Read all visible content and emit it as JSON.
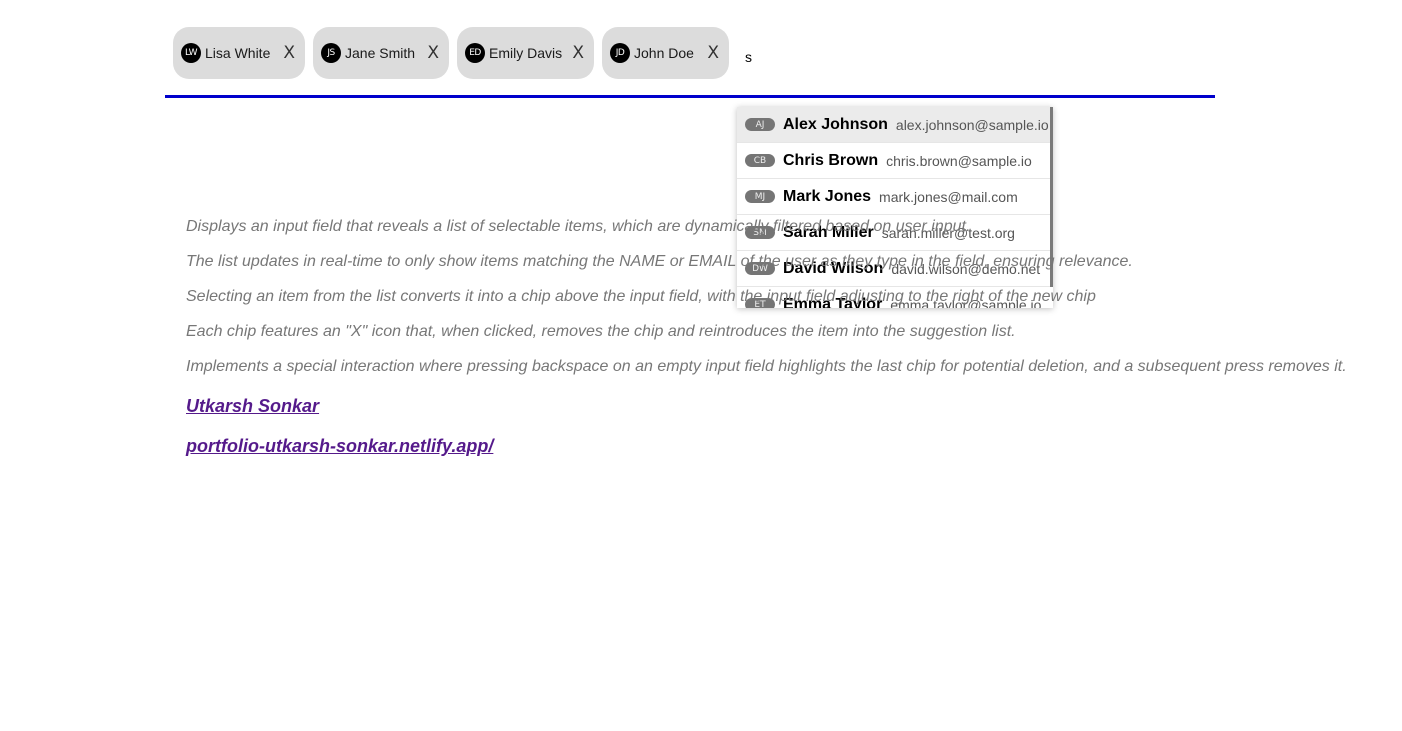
{
  "chips": [
    {
      "initials": "LW",
      "name": "Lisa White",
      "remove_label": "X"
    },
    {
      "initials": "JS",
      "name": "Jane Smith",
      "remove_label": "X"
    },
    {
      "initials": "ED",
      "name": "Emily Davis",
      "remove_label": "X"
    },
    {
      "initials": "JD",
      "name": "John Doe",
      "remove_label": "X"
    }
  ],
  "input": {
    "value": "s",
    "placeholder": ""
  },
  "suggestions": [
    {
      "initials": "AJ",
      "name": "Alex Johnson",
      "email": "alex.johnson@sample.io",
      "highlighted": true
    },
    {
      "initials": "CB",
      "name": "Chris Brown",
      "email": "chris.brown@sample.io"
    },
    {
      "initials": "MJ",
      "name": "Mark Jones",
      "email": "mark.jones@mail.com"
    },
    {
      "initials": "SM",
      "name": "Sarah Miller",
      "email": "sarah.miller@test.org"
    },
    {
      "initials": "DW",
      "name": "David Wilson",
      "email": "david.wilson@demo.net"
    },
    {
      "initials": "ET",
      "name": "Emma Taylor",
      "email": "emma.taylor@sample.io"
    }
  ],
  "description": [
    "Displays an input field that reveals a list of selectable items, which are dynamically filtered based on user input.",
    "The list updates in real-time to only show items matching the NAME or EMAIL of the user as they type in the field, ensuring relevance.",
    "Selecting an item from the list converts it into a chip above the input field, with the input field adjusting to the right of the new chip",
    "Each chip features an \"X\" icon that, when clicked, removes the chip and reintroduces the item into the suggestion list.",
    "Implements a special interaction where pressing backspace on an empty input field highlights the last chip for potential deletion, and a subsequent press removes it."
  ],
  "links": {
    "author": "Utkarsh Sonkar",
    "portfolio": "portfolio-utkarsh-sonkar.netlify.app/"
  },
  "colors": {
    "underline": "#0000cc",
    "chip_bg": "#dcdcdc",
    "link": "#551a8b",
    "description_text": "#777777"
  }
}
